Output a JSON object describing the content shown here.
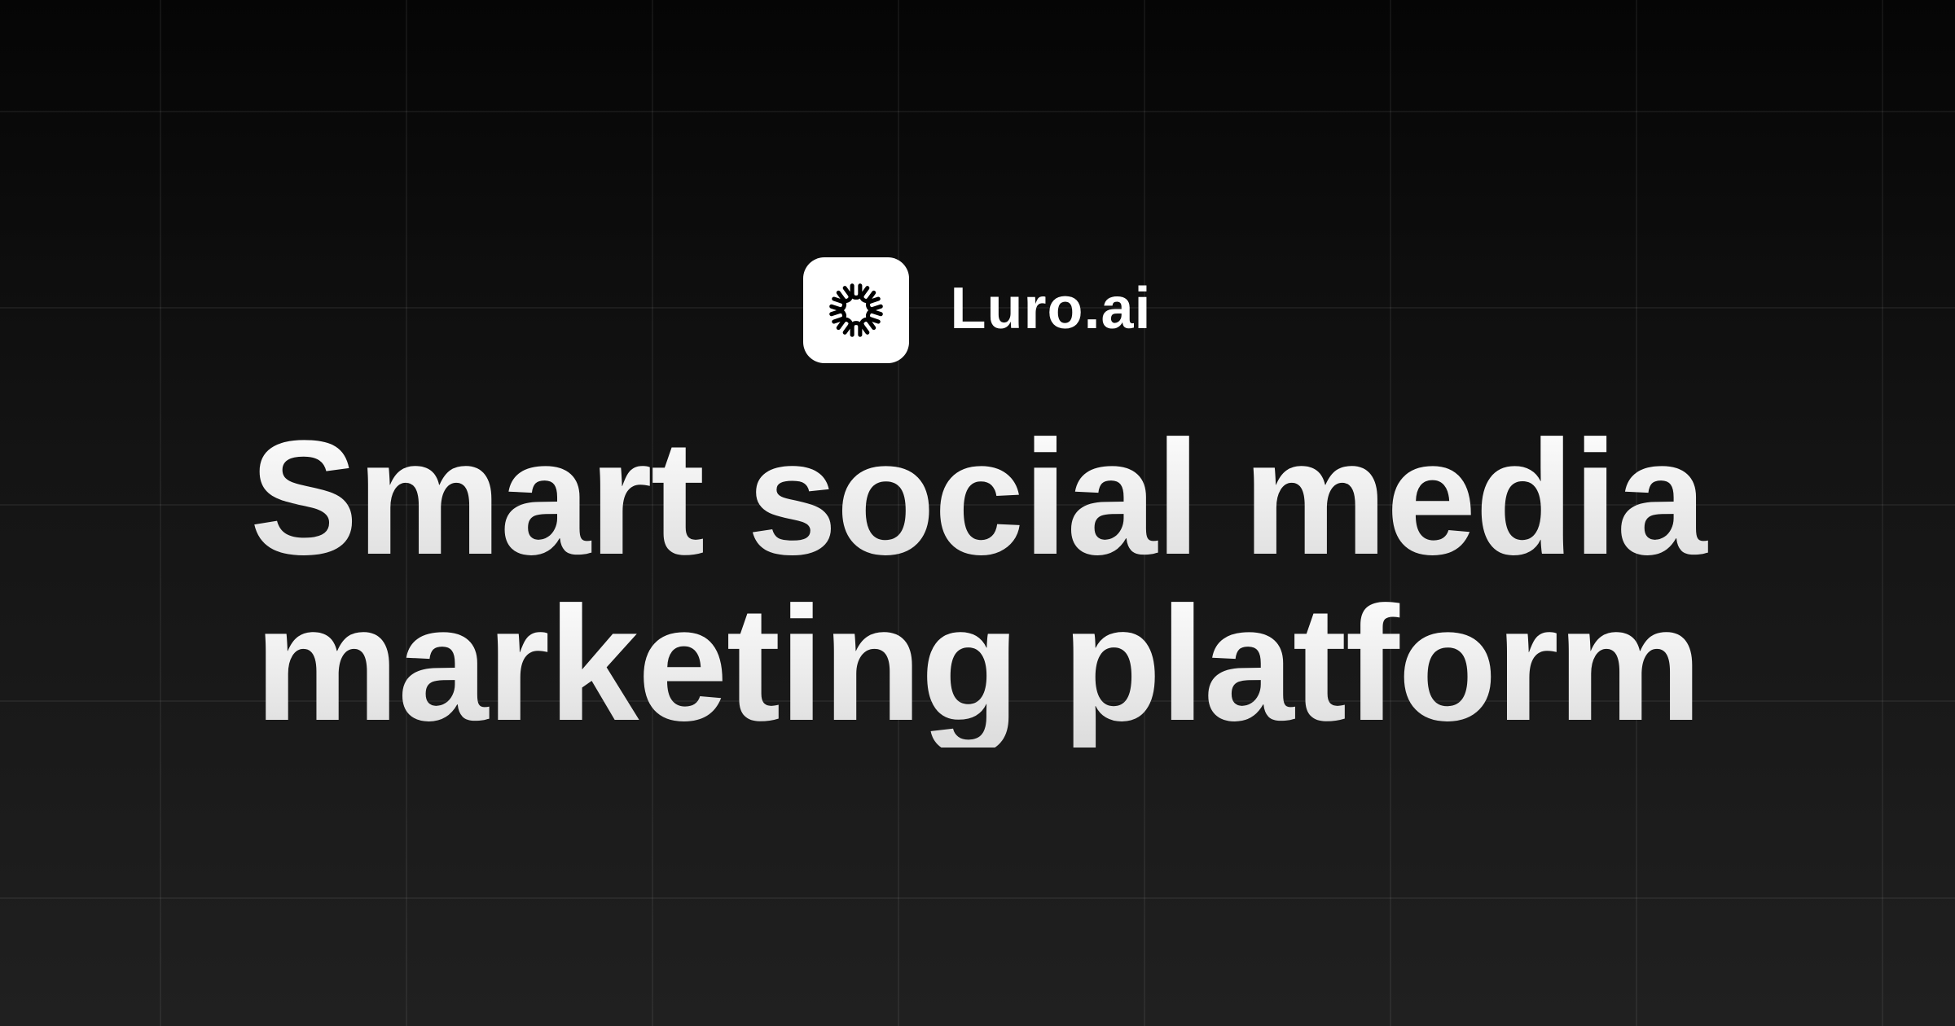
{
  "brand": {
    "name": "Luro.ai",
    "logo_icon": "luro-sunburst-icon"
  },
  "headline": {
    "line1": "Smart social media",
    "line2": "marketing platform"
  },
  "colors": {
    "background_top": "#050505",
    "background_bottom": "#202020",
    "text": "#ffffff",
    "logo_tile": "#ffffff",
    "logo_mark": "#000000",
    "grid_line": "#2a2a2a"
  }
}
